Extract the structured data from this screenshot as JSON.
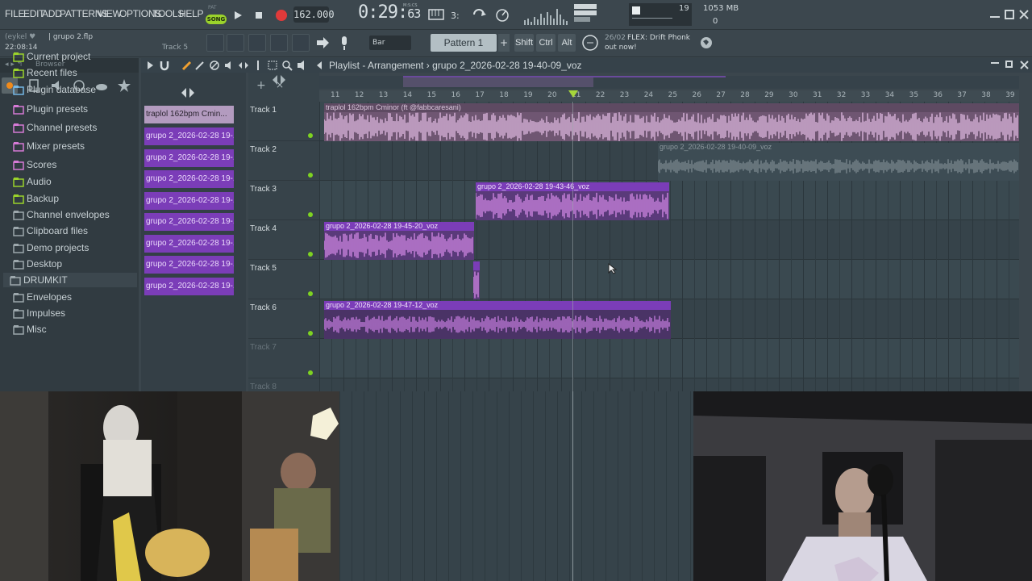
{
  "menu": [
    "FILE",
    "EDIT",
    "ADD",
    "PATTERNS",
    "VIEW",
    "OPTIONS",
    "TOOLS",
    "HELP"
  ],
  "transport": {
    "mode_pat": "PAT",
    "mode_song": "SONG",
    "tempo": "162.000",
    "time_main": "0:29:",
    "time_small": "63",
    "time_unit": "M:S:CS"
  },
  "cpu": {
    "value": "19",
    "memory": "1053 MB",
    "polyphony": "0"
  },
  "hint": {
    "user": "(eykel ♥",
    "file": "| grupo 2.flp",
    "clock": "22:08:14",
    "track": "Track 5"
  },
  "toolbar": {
    "snap": "Bar",
    "pattern": "Pattern 1",
    "pattern_add": "+",
    "keys": [
      "Shift",
      "Ctrl",
      "Alt"
    ]
  },
  "news": {
    "date": "26/02",
    "line1": "FLEX: Drift Phonk",
    "line2": "out now!"
  },
  "browser": {
    "title": "Browser",
    "items": [
      {
        "label": "Current project",
        "color": "#9bd32b"
      },
      {
        "label": "Recent files",
        "color": "#9bd32b"
      },
      {
        "label": "Plugin database",
        "color": "#74b7e6"
      },
      {
        "label": "Plugin presets",
        "color": "#d67ad6"
      },
      {
        "label": "Channel presets",
        "color": "#d67ad6"
      },
      {
        "label": "Mixer presets",
        "color": "#d67ad6"
      },
      {
        "label": "Scores",
        "color": "#d67ad6"
      },
      {
        "label": "Audio",
        "color": "#9bd32b"
      },
      {
        "label": "Backup",
        "color": "#9bd32b"
      },
      {
        "label": "Channel envelopes",
        "color": "#9ca7ac"
      },
      {
        "label": "Clipboard files",
        "color": "#9ca7ac"
      },
      {
        "label": "Demo projects",
        "color": "#9ca7ac"
      },
      {
        "label": "Desktop",
        "color": "#9ca7ac"
      },
      {
        "label": "DRUMKIT",
        "color": "#9ca7ac"
      },
      {
        "label": "Envelopes",
        "color": "#9ca7ac"
      },
      {
        "label": "Impulses",
        "color": "#9ca7ac"
      },
      {
        "label": "Misc",
        "color": "#9ca7ac"
      }
    ]
  },
  "picker": [
    "traplol 162bpm Cmin...",
    "grupo 2_2026-02-28 19-...",
    "grupo 2_2026-02-28 19-...",
    "grupo 2_2026-02-28 19-...",
    "grupo 2_2026-02-28 19-...",
    "grupo 2_2026-02-28 19-...",
    "grupo 2_2026-02-28 19-...",
    "grupo 2_2026-02-28 19-...",
    "grupo 2_2026-02-28 19-..."
  ],
  "playlist": {
    "title": "Playlist - Arrangement",
    "breadcrumb": "grupo 2_2026-02-28 19-40-09_voz",
    "ruler": [
      "11",
      "12",
      "13",
      "14",
      "15",
      "16",
      "17",
      "18",
      "19",
      "20",
      "21",
      "22",
      "23",
      "24",
      "25",
      "26",
      "27",
      "28",
      "29",
      "30",
      "31",
      "32",
      "33",
      "34",
      "35",
      "36",
      "37",
      "38",
      "39"
    ],
    "tracks": [
      "Track 1",
      "Track 2",
      "Track 3",
      "Track 4",
      "Track 5",
      "Track 6",
      "Track 7",
      "Track 8"
    ],
    "clips": {
      "c1": "traplol 162bpm Cminor (ft @fabbcaresani)",
      "c2": "grupo 2_2026-02-28 19-40-09_voz",
      "c3": "grupo 2_2026-02-28 19-43-46_voz",
      "c4": "grupo 2_2026-02-28 19-45-20_voz",
      "c6": "grupo 2_2026-02-28 19-47-12_voz"
    }
  },
  "colors": {
    "accent_green": "#9bd32b",
    "clip_purple": "#7b3db8",
    "clip_pink": "#c9a1cf"
  }
}
